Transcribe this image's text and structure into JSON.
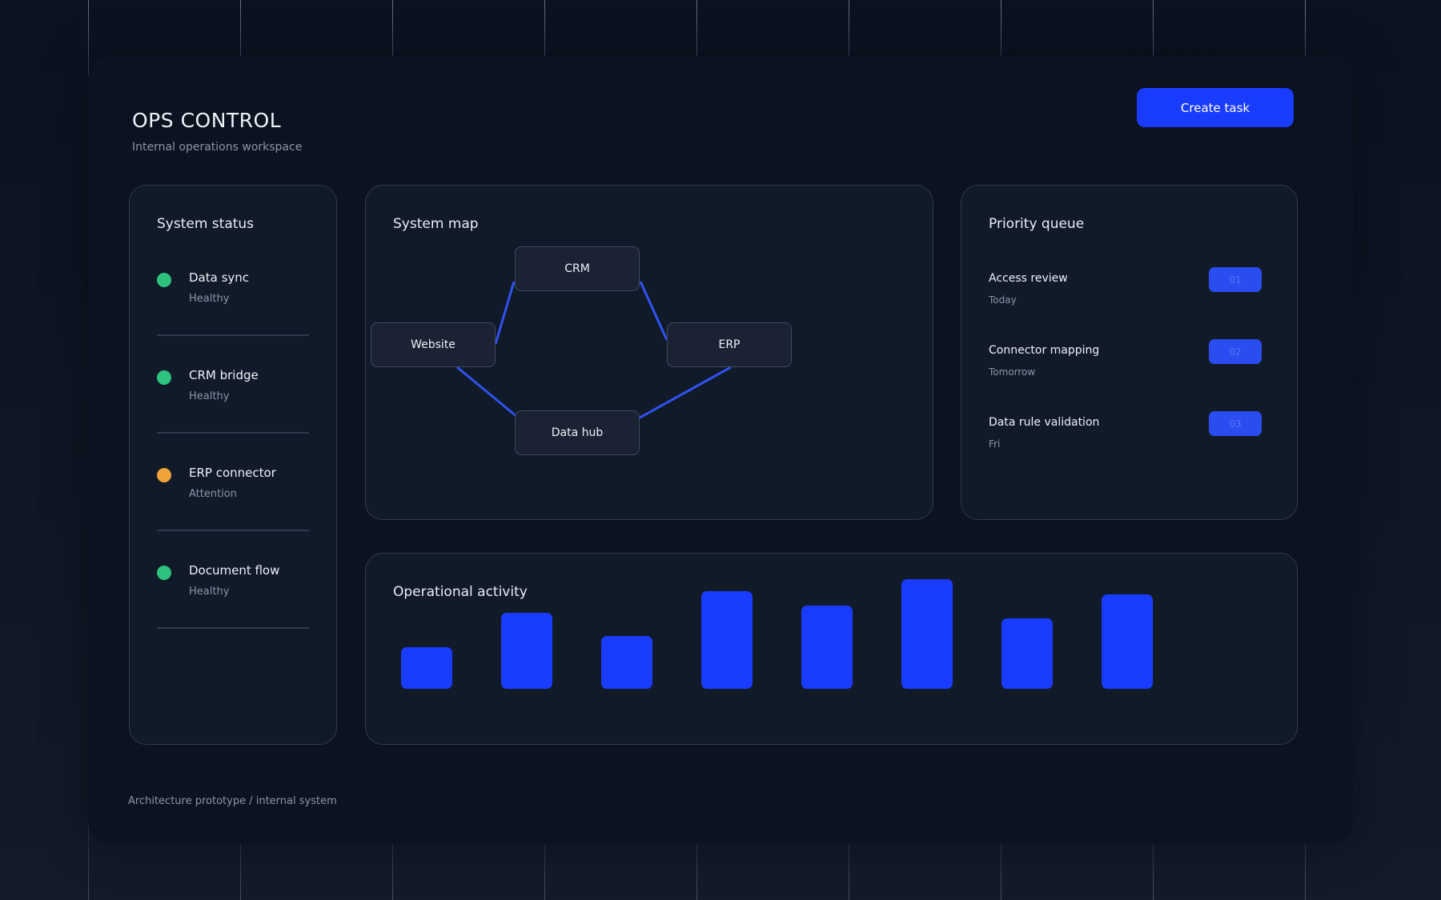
{
  "header": {
    "title": "OPS CONTROL",
    "subtitle": "Internal operations workspace",
    "create_button": "Create task"
  },
  "status_panel": {
    "title": "System status",
    "items": [
      {
        "name": "Data sync",
        "state": "Healthy",
        "color": "#2ec27e"
      },
      {
        "name": "CRM bridge",
        "state": "Healthy",
        "color": "#2ec27e"
      },
      {
        "name": "ERP connector",
        "state": "Attention",
        "color": "#f0a33a"
      },
      {
        "name": "Document flow",
        "state": "Healthy",
        "color": "#2ec27e"
      }
    ]
  },
  "map_panel": {
    "title": "System map",
    "nodes": {
      "crm": "CRM",
      "website": "Website",
      "erp": "ERP",
      "hub": "Data hub"
    },
    "edge_color": "#2f52f0"
  },
  "queue_panel": {
    "title": "Priority queue",
    "items": [
      {
        "name": "Access review",
        "when": "Today",
        "rank": "01"
      },
      {
        "name": "Connector mapping",
        "when": "Tomorrow",
        "rank": "02"
      },
      {
        "name": "Data rule validation",
        "when": "Fri",
        "rank": "03"
      }
    ]
  },
  "activity_panel": {
    "title": "Operational activity",
    "values": [
      0.38,
      0.69,
      0.48,
      0.89,
      0.76,
      1.0,
      0.64,
      0.86
    ],
    "bar_color": "#1a3cff"
  },
  "footer": "Architecture prototype / internal system",
  "colors": {
    "accent": "#1a3cff",
    "background": "#0b1220",
    "panel": "#111a28"
  }
}
